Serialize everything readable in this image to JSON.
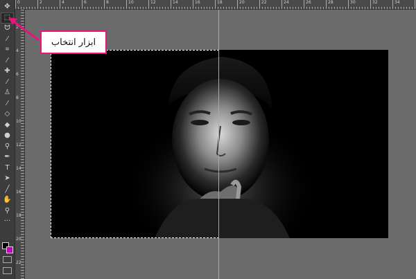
{
  "callout": {
    "label": "ابزار انتخاب"
  },
  "ruler": {
    "top_numbers": [
      "0",
      "2",
      "4",
      "6",
      "8",
      "10",
      "12",
      "14",
      "16",
      "18",
      "20",
      "22",
      "24",
      "26",
      "28",
      "30",
      "32",
      "34"
    ],
    "left_numbers": [
      "2",
      "4",
      "6",
      "8",
      "10",
      "12",
      "14",
      "16",
      "18",
      "20",
      "22"
    ]
  },
  "toolbar": {
    "tools": [
      {
        "name": "move-tool",
        "glyph": "✥"
      },
      {
        "name": "rectangular-marquee-tool",
        "glyph": "⬚"
      },
      {
        "name": "lasso-tool",
        "glyph": "ᗢ"
      },
      {
        "name": "quick-selection-tool",
        "glyph": "⁄"
      },
      {
        "name": "crop-tool",
        "glyph": "⌗"
      },
      {
        "name": "eyedropper-tool",
        "glyph": "⁄"
      },
      {
        "name": "healing-brush-tool",
        "glyph": "✚"
      },
      {
        "name": "brush-tool",
        "glyph": "⁄"
      },
      {
        "name": "clone-stamp-tool",
        "glyph": "♙"
      },
      {
        "name": "history-brush-tool",
        "glyph": "⁄"
      },
      {
        "name": "eraser-tool",
        "glyph": "◇"
      },
      {
        "name": "paint-bucket-tool",
        "glyph": "◆"
      },
      {
        "name": "blur-tool",
        "glyph": "●"
      },
      {
        "name": "dodge-tool",
        "glyph": "⚲"
      },
      {
        "name": "pen-tool",
        "glyph": "✒"
      },
      {
        "name": "type-tool",
        "glyph": "T"
      },
      {
        "name": "path-selection-tool",
        "glyph": "➤"
      },
      {
        "name": "line-tool",
        "glyph": "╱"
      },
      {
        "name": "hand-tool",
        "glyph": "✋"
      },
      {
        "name": "zoom-tool",
        "glyph": "⚲"
      },
      {
        "name": "more-tools",
        "glyph": "···"
      }
    ]
  },
  "colors": {
    "accent_pink": "#e8147e",
    "guide_cyan": "#4fd0d0",
    "foreground_color": "#000000",
    "background_color": "#c000c0"
  }
}
